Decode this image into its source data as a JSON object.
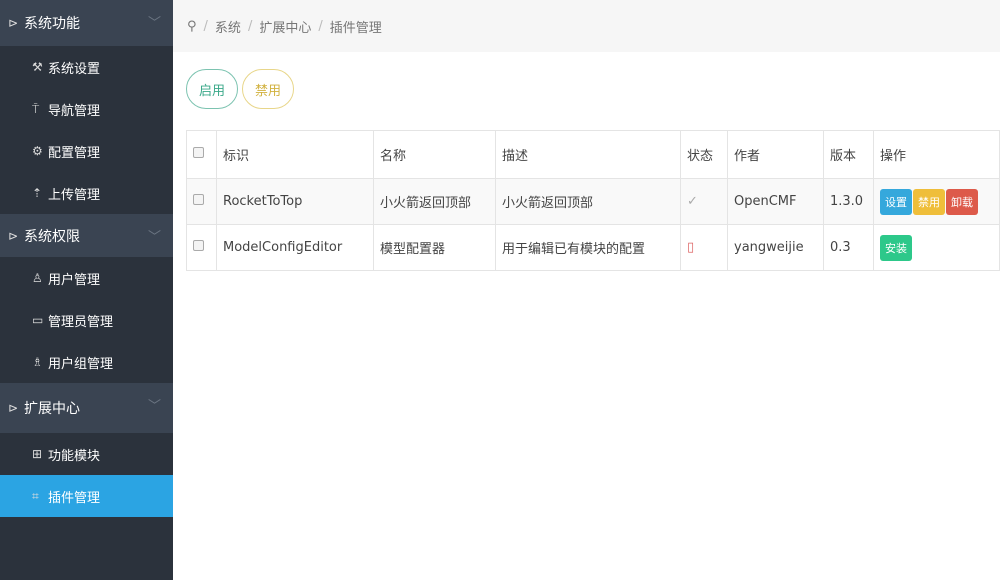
{
  "sidebar": {
    "groups": [
      {
        "label": "系统功能",
        "items": [
          {
            "label": "系统设置",
            "icon": "wrench-icon"
          },
          {
            "label": "导航管理",
            "icon": "sign-icon"
          },
          {
            "label": "配置管理",
            "icon": "gears-icon"
          },
          {
            "label": "上传管理",
            "icon": "upload-icon"
          }
        ]
      },
      {
        "label": "系统权限",
        "items": [
          {
            "label": "用户管理",
            "icon": "user-icon"
          },
          {
            "label": "管理员管理",
            "icon": "lock-icon"
          },
          {
            "label": "用户组管理",
            "icon": "users-icon"
          }
        ]
      },
      {
        "label": "扩展中心",
        "items": [
          {
            "label": "功能模块",
            "icon": "grid-icon"
          },
          {
            "label": "插件管理",
            "icon": "plugin-icon"
          }
        ]
      }
    ]
  },
  "breadcrumb": [
    "系统",
    "扩展中心",
    "插件管理"
  ],
  "toolbar": {
    "enable": "启用",
    "disable": "禁用"
  },
  "table": {
    "headers": [
      "标识",
      "名称",
      "描述",
      "状态",
      "作者",
      "版本",
      "操作"
    ],
    "rows": [
      {
        "id": "RocketToTop",
        "name": "小火箭返回顶部",
        "desc": "小火箭返回顶部",
        "status": "✓",
        "author": "OpenCMF",
        "version": "1.3.0",
        "actions": [
          "设置",
          "禁用",
          "卸载"
        ]
      },
      {
        "id": "ModelConfigEditor",
        "name": "模型配置器",
        "desc": "用于编辑已有模块的配置",
        "status": "▯",
        "author": "yangweijie",
        "version": "0.3",
        "actions": [
          "安装"
        ]
      }
    ]
  },
  "colors": {
    "sidebar": "#2b323c",
    "active": "#2ba4e3",
    "info": "#35a8dc",
    "warning": "#efbe3a",
    "danger": "#dd5a4a",
    "success": "#2dc88a"
  }
}
